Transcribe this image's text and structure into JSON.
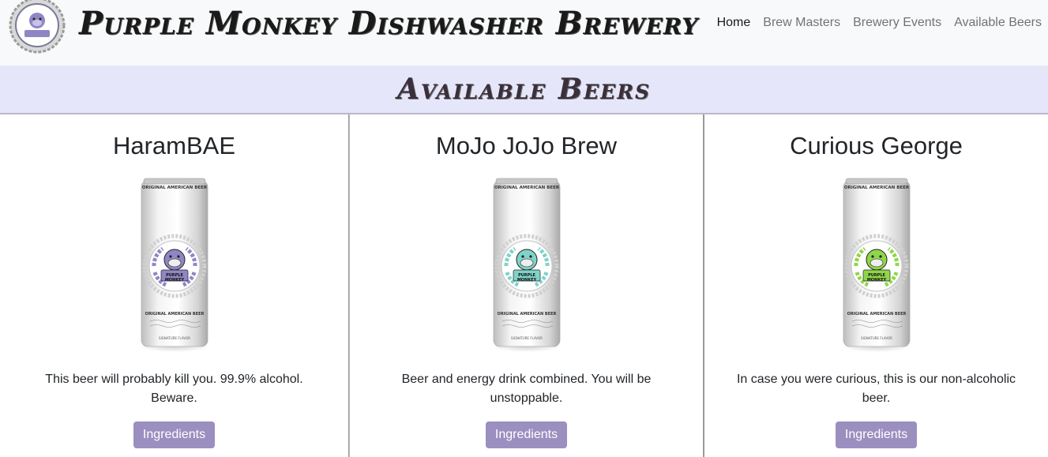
{
  "brand": "Purple Monkey Dishwasher Brewery",
  "nav": {
    "items": [
      {
        "label": "Home",
        "active": true
      },
      {
        "label": "Brew Masters",
        "active": false
      },
      {
        "label": "Brewery Events",
        "active": false
      },
      {
        "label": "Available Beers",
        "active": false
      }
    ]
  },
  "section_title": "Available Beers",
  "beers": [
    {
      "name": "HaramBAE",
      "description": "This beer will probably kill you. 99.9% alcohol. Beware.",
      "button": "Ingredients",
      "accent": "#8f86c4"
    },
    {
      "name": "MoJo JoJo Brew",
      "description": "Beer and energy drink combined. You will be unstoppable.",
      "button": "Ingredients",
      "accent": "#7fd3c9"
    },
    {
      "name": "Curious George",
      "description": "In case you were curious, this is our non-alcoholic beer.",
      "button": "Ingredients",
      "accent": "#8fd64a"
    }
  ],
  "can_label": {
    "top": "ORIGINAL AMERICAN BEER",
    "bottom": "ORIGINAL AMERICAN BEER",
    "badge": "PURPLE MONKEY DISHWASHER",
    "flavor": "SIGNATURE FLAVOR"
  },
  "colors": {
    "navbar_bg": "#f8f9fa",
    "header_bg": "#e6e6fa",
    "button_bg": "#9b8fbf"
  }
}
